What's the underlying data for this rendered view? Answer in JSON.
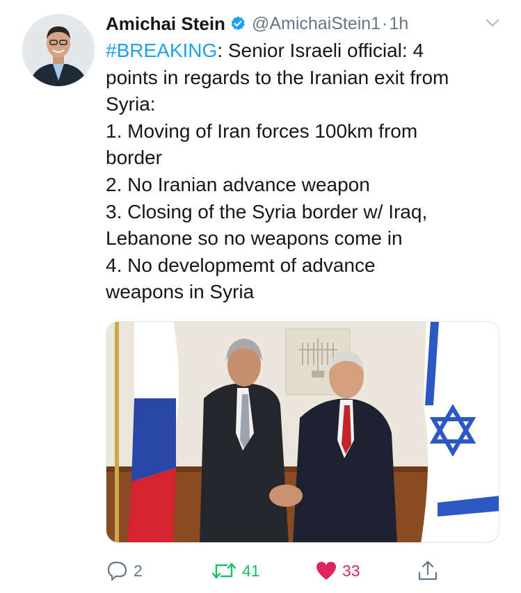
{
  "author": {
    "display_name": "Amichai Stein",
    "handle": "@AmichaiStein1",
    "separator": "·",
    "time": "1h",
    "verified": true
  },
  "tweet": {
    "lines": [
      {
        "hashtag": "#BREAKING",
        "text": ": Senior Israeli official: 4"
      },
      {
        "text": "points in regards to the Iranian exit from"
      },
      {
        "text": "Syria:"
      },
      {
        "text": "1. Moving of Iran forces 100km from"
      },
      {
        "text": "border"
      },
      {
        "text": "2. No Iranian advance weapon"
      },
      {
        "text": "3. Closing of the Syria border w/ Iraq,"
      },
      {
        "text": "Lebanone so no weapons come in"
      },
      {
        "text": "4. No developmemt of advance"
      },
      {
        "text": "weapons in Syria"
      }
    ]
  },
  "actions": {
    "reply_count": "2",
    "retweet_count": "41",
    "like_count": "33"
  },
  "icons": {
    "verified": "verified-badge-icon",
    "caret": "chevron-down-icon",
    "reply": "reply-icon",
    "retweet": "retweet-icon",
    "like": "heart-icon",
    "share": "share-icon"
  },
  "colors": {
    "accent": "#1da1f2",
    "retweet": "#17bf63",
    "like": "#e0245e",
    "muted": "#657786",
    "text": "#14171a"
  }
}
